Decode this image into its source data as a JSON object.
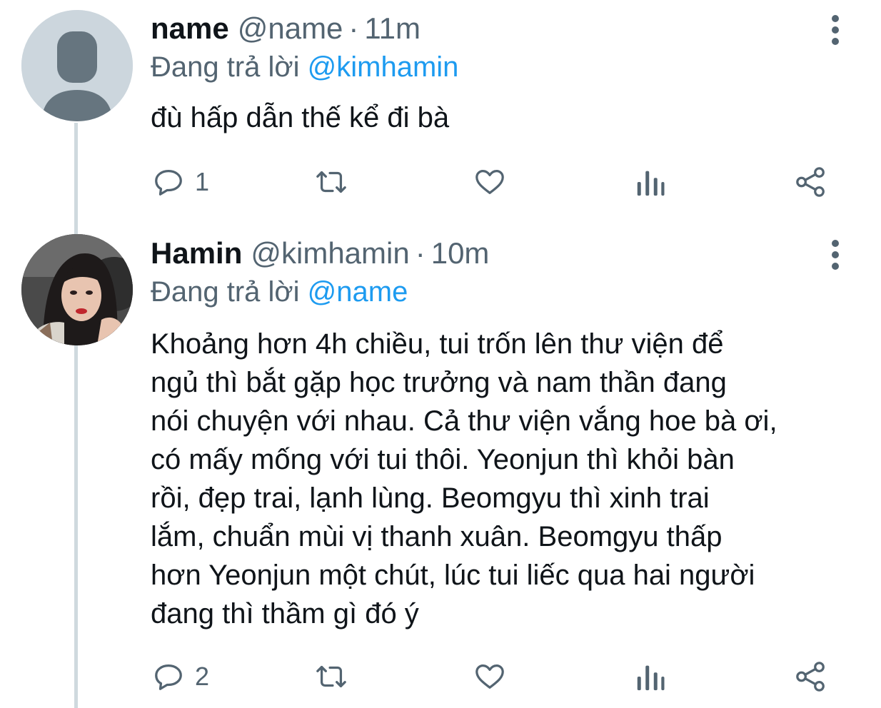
{
  "colors": {
    "text_primary": "#0f1419",
    "text_secondary": "#536471",
    "link": "#1d9bf0",
    "thread_line": "#cfd9de",
    "avatar_default": "#ccd6dd"
  },
  "tweets": [
    {
      "display_name": "name",
      "handle": "@name",
      "separator": "·",
      "time": "11m",
      "reply_prefix": "Đang trả lời",
      "reply_to": "@kimhamin",
      "text_lines": [
        "đù hấp dẫn thế kể đi bà"
      ],
      "avatar_icon": "default-profile-icon",
      "actions": {
        "reply_icon": "reply-icon",
        "reply_count": "1",
        "retweet_icon": "retweet-icon",
        "like_icon": "heart-icon",
        "views_icon": "views-icon",
        "share_icon": "share-icon"
      },
      "more_icon": "more-options-icon"
    },
    {
      "display_name": "Hamin",
      "handle": "@kimhamin",
      "separator": "·",
      "time": "10m",
      "reply_prefix": "Đang trả lời",
      "reply_to": "@name",
      "text_lines": [
        "Khoảng hơn 4h chiều, tui trốn lên thư viện để",
        "ngủ thì bắt gặp học trưởng và nam thần đang",
        "nói chuyện với nhau. Cả thư viện vắng hoe bà ơi,",
        "có mấy mống với tui thôi. Yeonjun thì khỏi bàn",
        "rồi, đẹp trai, lạnh lùng. Beomgyu thì xinh trai",
        "lắm, chuẩn mùi vị thanh xuân. Beomgyu thấp",
        "hơn Yeonjun một chút, lúc tui liếc qua hai người",
        "đang thì thầm gì đó ý"
      ],
      "avatar_icon": "profile-photo",
      "actions": {
        "reply_icon": "reply-icon",
        "reply_count": "2",
        "retweet_icon": "retweet-icon",
        "like_icon": "heart-icon",
        "views_icon": "views-icon",
        "share_icon": "share-icon"
      },
      "more_icon": "more-options-icon"
    }
  ]
}
